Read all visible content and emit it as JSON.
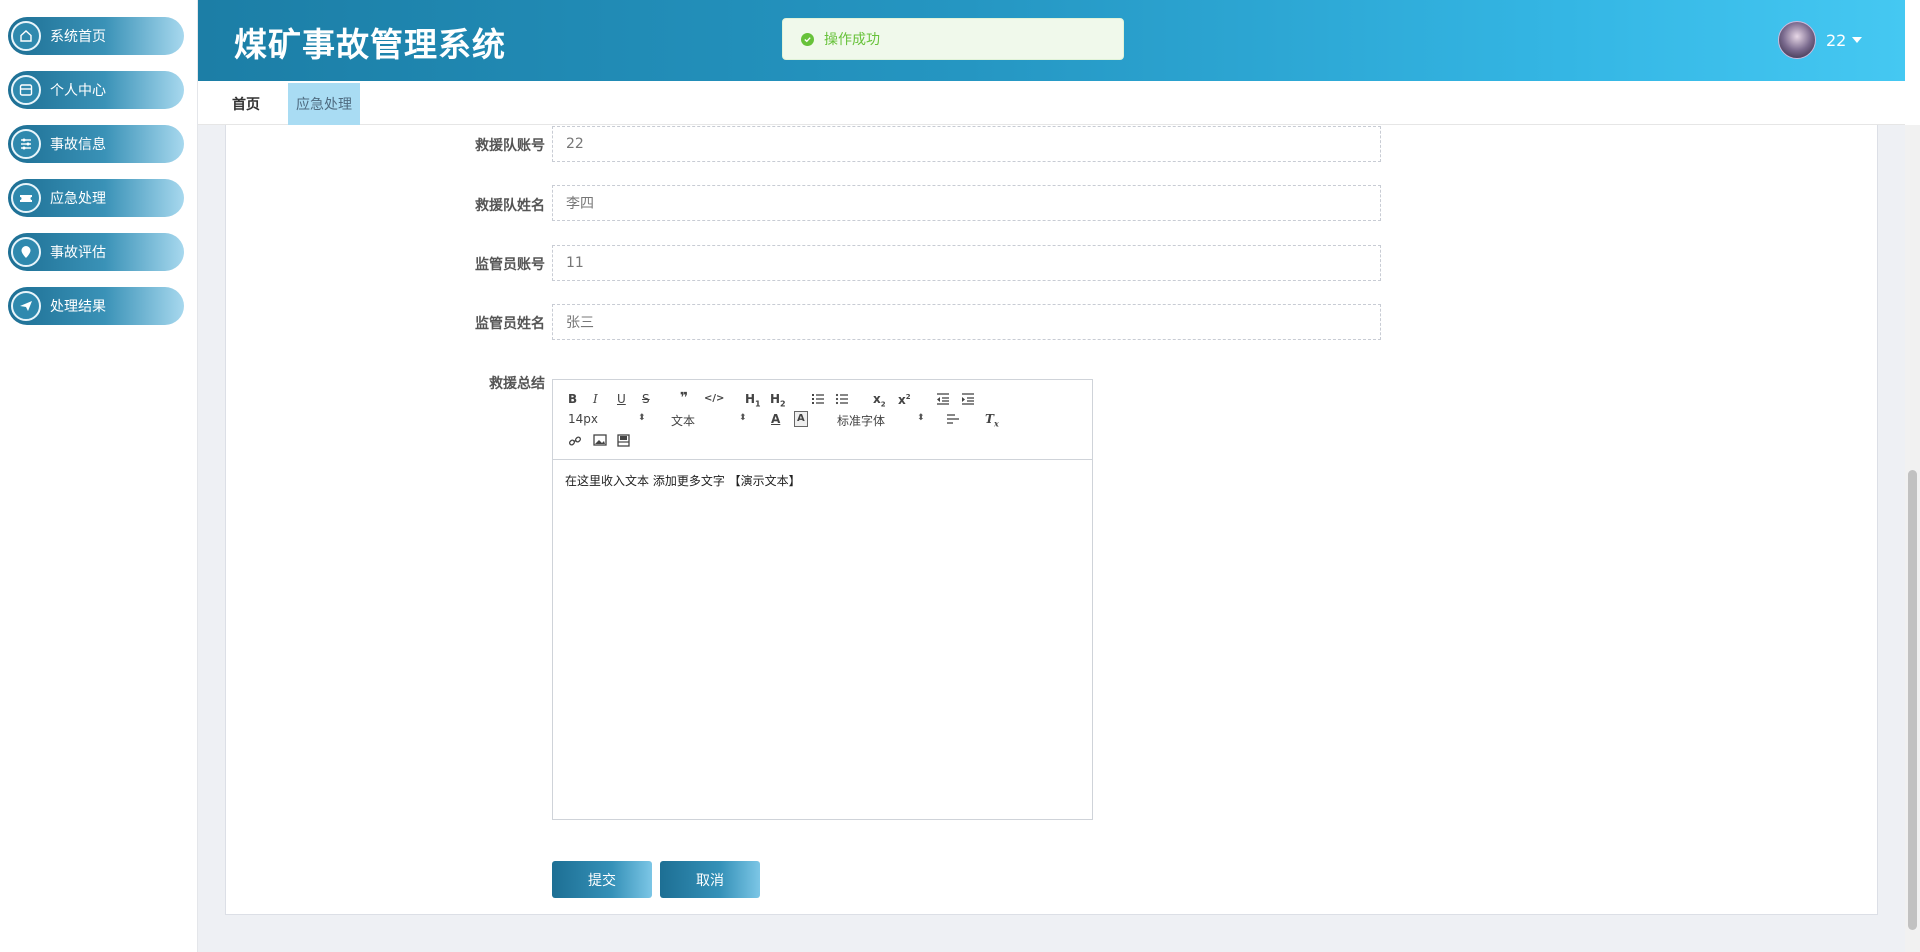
{
  "sidebar": {
    "items": [
      {
        "label": "系统首页",
        "icon": "home-icon"
      },
      {
        "label": "个人中心",
        "icon": "id-card-icon"
      },
      {
        "label": "事故信息",
        "icon": "sliders-icon"
      },
      {
        "label": "应急处理",
        "icon": "ticket-icon"
      },
      {
        "label": "事故评估",
        "icon": "location-pin-icon"
      },
      {
        "label": "处理结果",
        "icon": "send-icon"
      }
    ]
  },
  "header": {
    "title": "煤矿事故管理系统",
    "toast": "操作成功",
    "username": "22"
  },
  "tabs": [
    {
      "label": "首页"
    },
    {
      "label": "应急处理"
    }
  ],
  "form": {
    "rescue_team_account": {
      "label": "救援队账号",
      "value": "22"
    },
    "rescue_team_name": {
      "label": "救援队姓名",
      "value": "李四"
    },
    "supervisor_account": {
      "label": "监管员账号",
      "value": "11"
    },
    "supervisor_name": {
      "label": "监管员姓名",
      "value": "张三"
    },
    "rescue_summary": {
      "label": "救援总结"
    }
  },
  "editor": {
    "font_size": "14px",
    "header_select": "文本",
    "font_family": "标准字体",
    "content": "在这里收入文本 添加更多文字 【演示文本】"
  },
  "buttons": {
    "submit": "提交",
    "cancel": "取消"
  },
  "colors": {
    "accent": "#1d6f94",
    "header_right": "#45c8f2",
    "success": "#67c23a",
    "tab_active": "#a9dcf3"
  }
}
